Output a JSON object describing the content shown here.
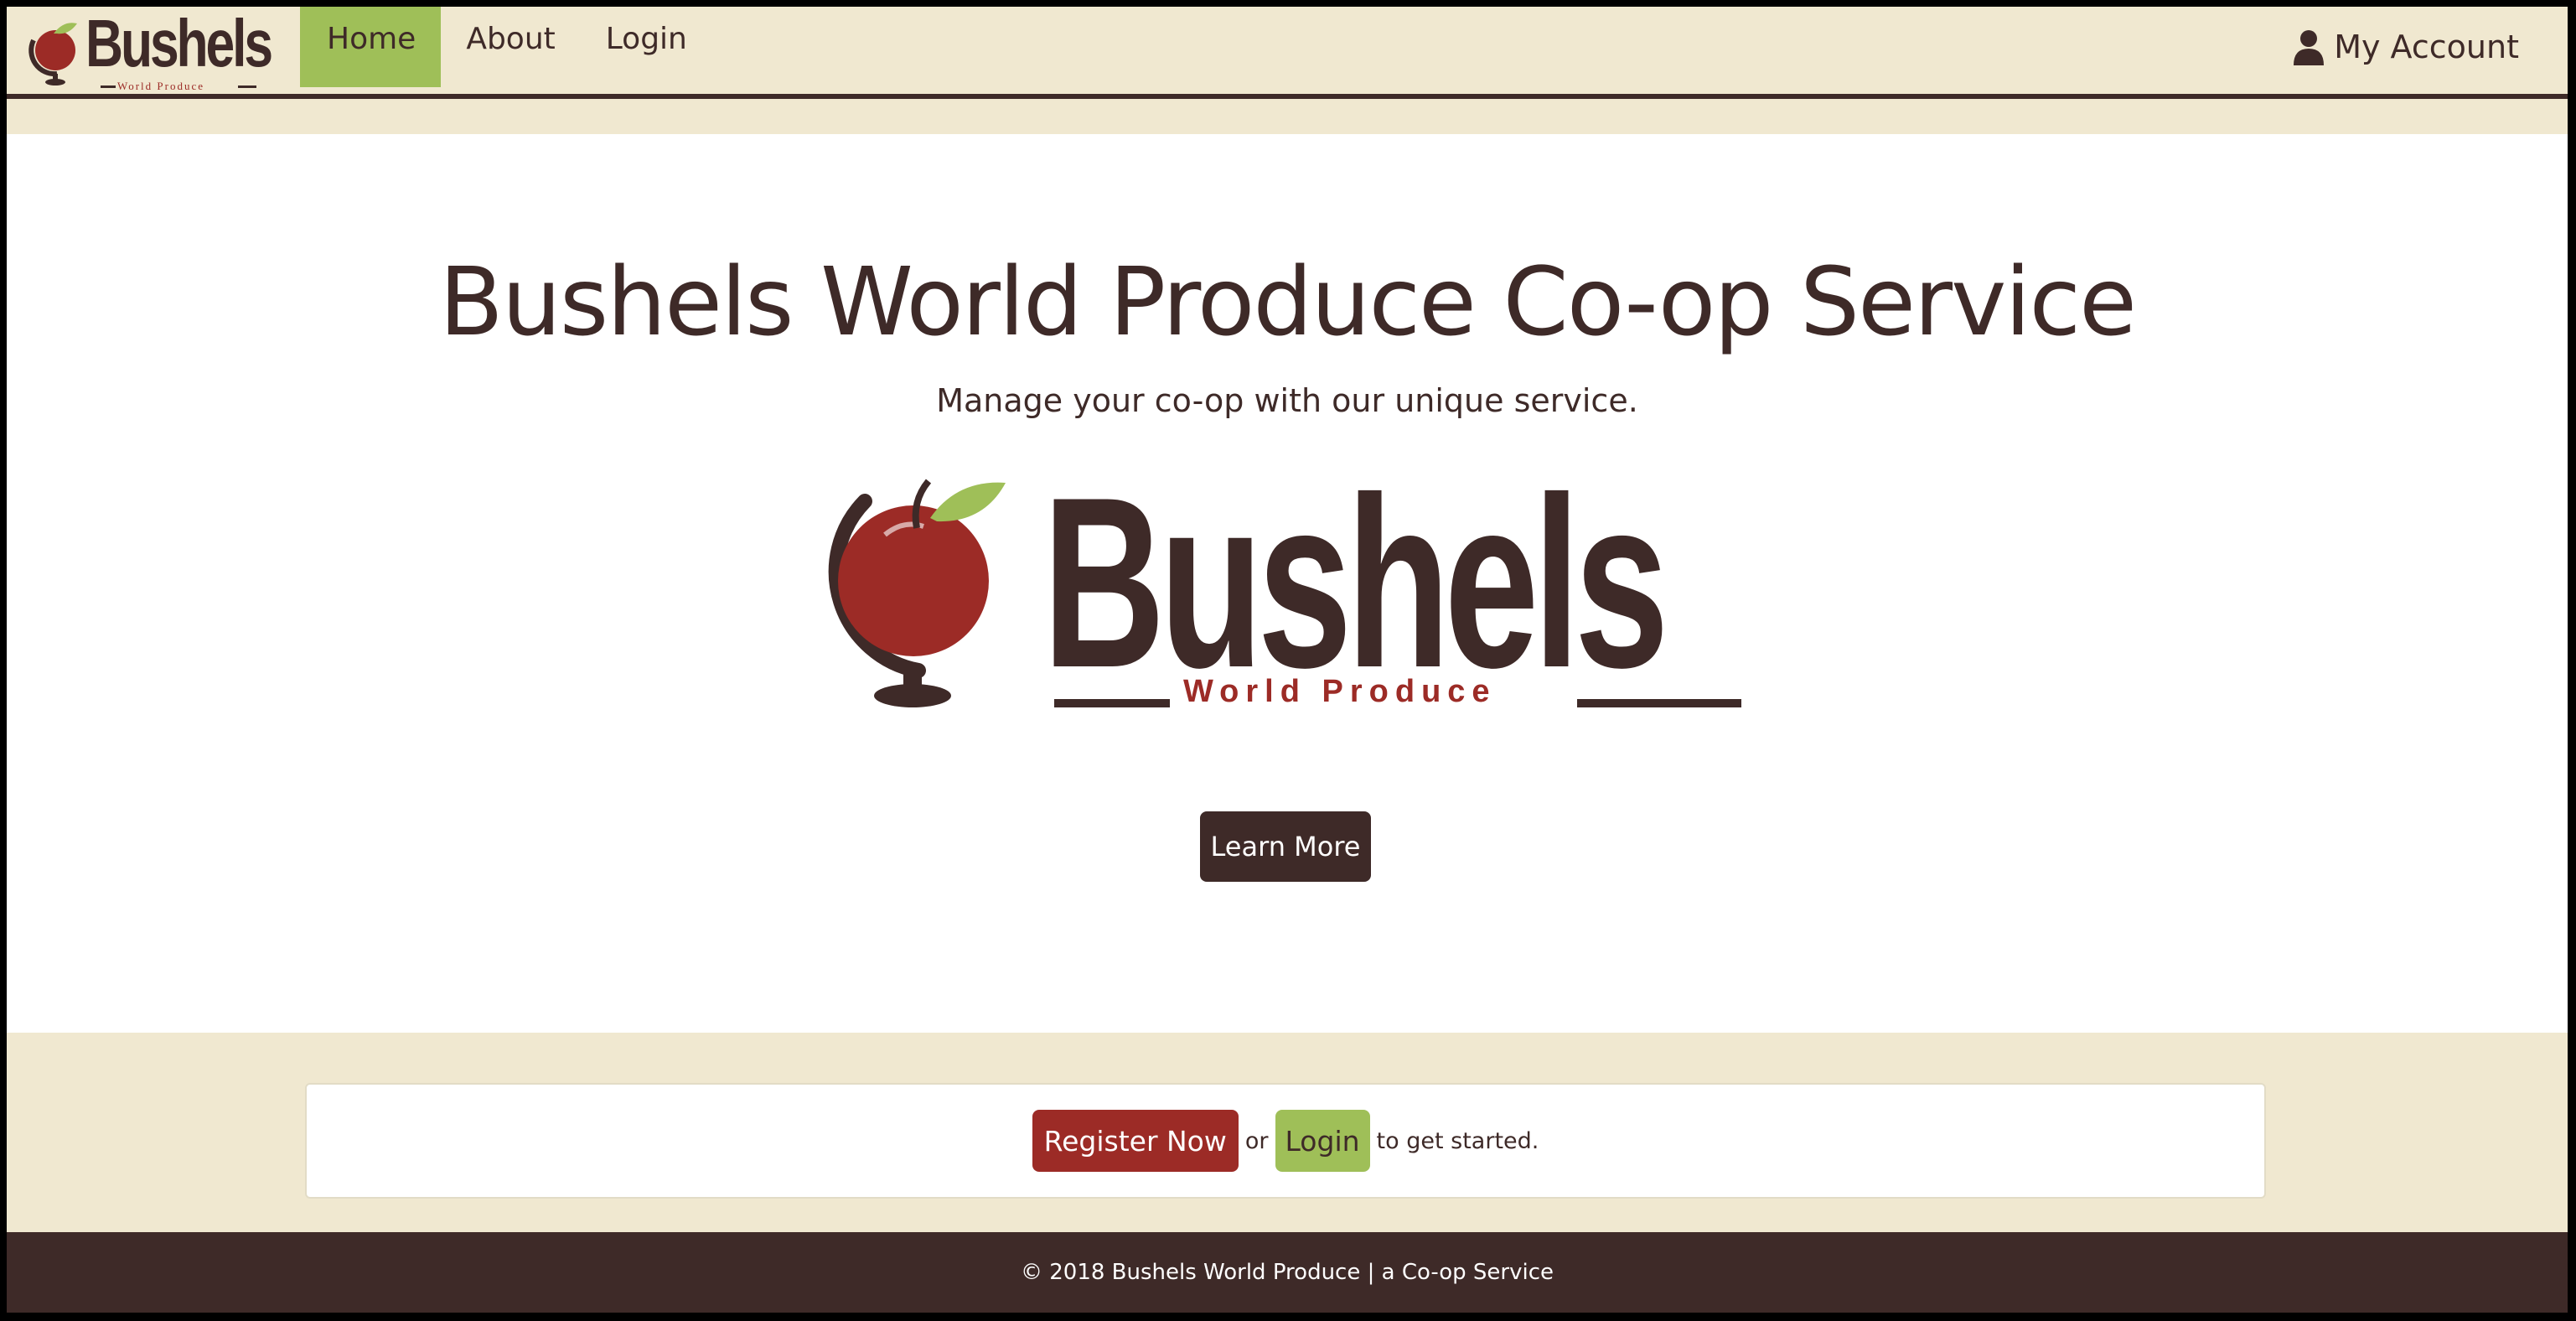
{
  "brand": {
    "name": "Bushels",
    "tagline": "World Produce"
  },
  "nav": {
    "items": [
      {
        "label": "Home",
        "active": true
      },
      {
        "label": "About",
        "active": false
      },
      {
        "label": "Login",
        "active": false
      }
    ],
    "account_label": "My Account",
    "account_icon": "user-icon"
  },
  "hero": {
    "title": "Bushels World Produce Co-op Service",
    "subtitle": "Manage your co-op with our unique service.",
    "logo_name": "Bushels",
    "logo_tagline": "World Produce",
    "learn_more_label": "Learn More"
  },
  "cta": {
    "register_label": "Register Now",
    "or_text": "or",
    "login_label": "Login",
    "tail_text": "to get started."
  },
  "footer": {
    "text": "© 2018 Bushels World Produce | a Co-op Service"
  },
  "colors": {
    "brown": "#3e2a28",
    "cream": "#f0e8d0",
    "green": "#9fbf58",
    "red": "#9c2b26"
  }
}
